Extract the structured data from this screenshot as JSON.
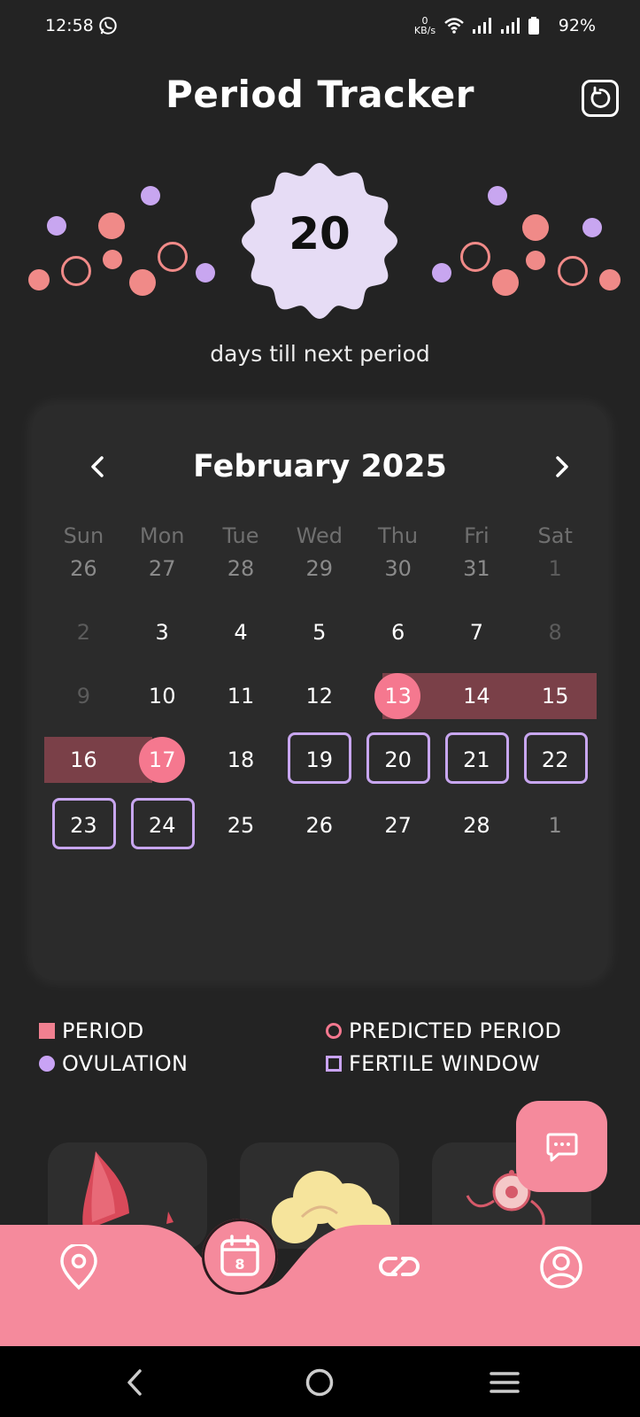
{
  "status_bar": {
    "time": "12:58",
    "net_speed_value": "0",
    "net_speed_unit": "KB/s",
    "battery": "92%"
  },
  "header": {
    "title": "Period Tracker"
  },
  "hero": {
    "days_count": "20",
    "subtitle": "days till next period"
  },
  "calendar": {
    "month_title": "February 2025",
    "weekdays": [
      "Sun",
      "Mon",
      "Tue",
      "Wed",
      "Thu",
      "Fri",
      "Sat"
    ],
    "weeks": [
      [
        "26",
        "27",
        "28",
        "29",
        "30",
        "31",
        "1"
      ],
      [
        "2",
        "3",
        "4",
        "5",
        "6",
        "7",
        "8"
      ],
      [
        "9",
        "10",
        "11",
        "12",
        "13",
        "14",
        "15"
      ],
      [
        "16",
        "17",
        "18",
        "19",
        "20",
        "21",
        "22"
      ],
      [
        "23",
        "24",
        "25",
        "26",
        "27",
        "28",
        "1"
      ]
    ],
    "period_days": [
      "13",
      "14",
      "15",
      "16",
      "17"
    ],
    "fertile_days": [
      "19",
      "20",
      "21",
      "22",
      "23",
      "24"
    ]
  },
  "legend": {
    "period": "PERIOD",
    "predicted_period": "PREDICTED PERIOD",
    "ovulation": "OVULATION",
    "fertile_window": "FERTILE WINDOW"
  },
  "bottom_nav": {
    "calendar_badge": "8"
  },
  "colors": {
    "background": "#232323",
    "card": "#2b2b2b",
    "period_pink": "#f5788f",
    "period_band": "#7a4048",
    "fertile_purple": "#c8a6f0",
    "nav_pink": "#f58a9c",
    "blob_lilac": "#e6dcf5"
  },
  "icons": {
    "status": [
      "whatsapp-icon",
      "wifi-icon",
      "signal-icon",
      "battery-icon"
    ],
    "header": "reset-icon",
    "fab": "chat-icon",
    "nav": [
      "location-icon",
      "calendar-icon",
      "link-icon",
      "profile-icon"
    ],
    "system": [
      "back-icon",
      "home-icon",
      "recents-icon"
    ]
  }
}
